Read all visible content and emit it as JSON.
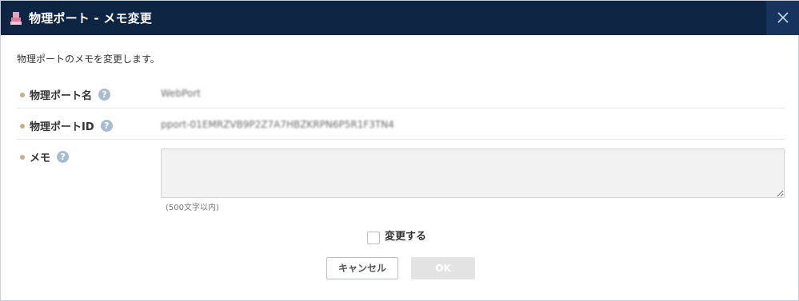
{
  "dialog": {
    "title": "物理ポート - メモ変更",
    "close_icon": "close-icon",
    "title_icon": "port-icon",
    "title_icon_color": "#e8a0b8"
  },
  "description": "物理ポートのメモを変更します。",
  "fields": [
    {
      "label": "物理ポート名",
      "value": "WebPort",
      "help": "?"
    },
    {
      "label": "物理ポートID",
      "value": "pport-01EMRZVB9P2Z7A7HBZKRPN6P5R1F3TN4",
      "help": "?"
    },
    {
      "label": "メモ",
      "value": "",
      "help": "?"
    }
  ],
  "memo": {
    "value": "",
    "hint": "(500文字以内)"
  },
  "confirm": {
    "label": "変更する",
    "checked": false
  },
  "buttons": {
    "cancel_label": "キャンセル",
    "ok_label": "OK"
  },
  "colors": {
    "header_bg": "#0d2442",
    "bullet": "#c3b087",
    "help_icon": "#a9bccf",
    "ok_disabled": "#e3e3e3"
  }
}
